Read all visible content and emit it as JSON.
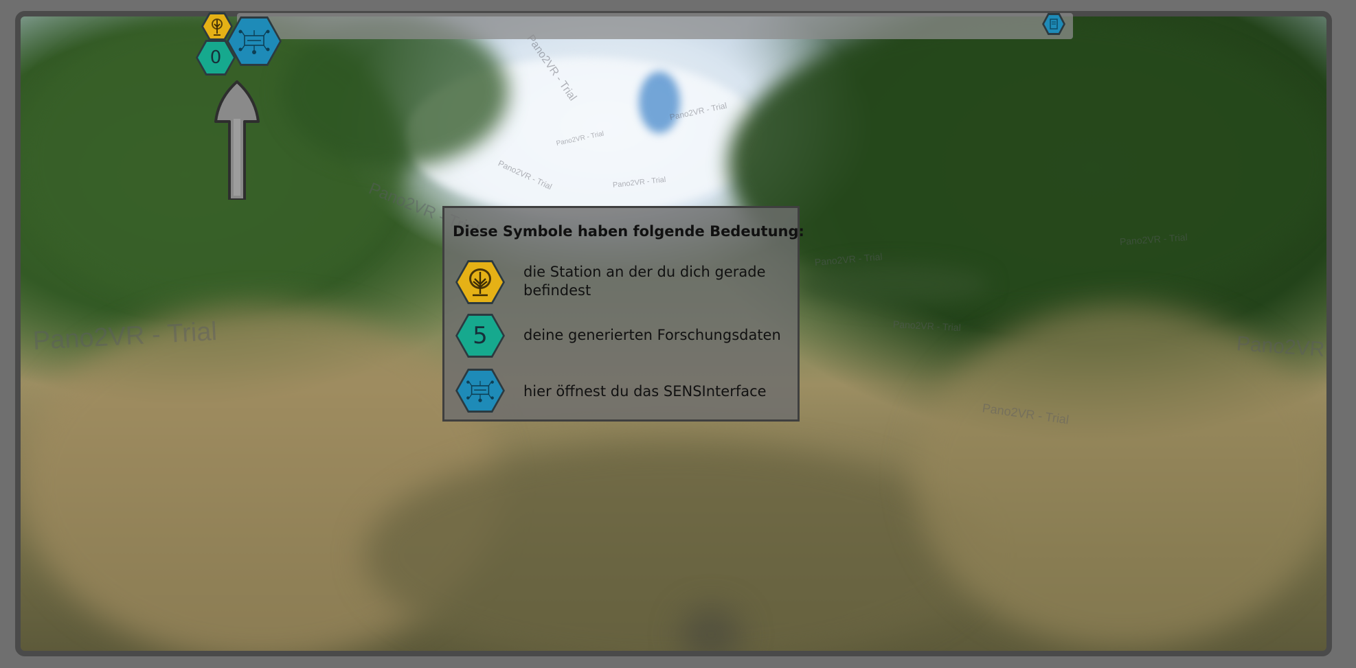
{
  "legend": {
    "title": "Diese Symbole haben folgende Bedeutung:",
    "rows": [
      {
        "icon": "tree-icon",
        "color": "#e5b116",
        "text": "die Station an der du dich gerade befindest"
      },
      {
        "icon": "data-counter-icon",
        "color": "#16a98e",
        "value": "5",
        "text": "deine generierten Forschungsdaten"
      },
      {
        "icon": "sens-interface-icon",
        "color": "#1e8bb8",
        "text": "hier öffnest du das SENSInterface"
      }
    ]
  },
  "hud": {
    "data_counter": "0",
    "station_icon": "tree-icon",
    "interface_icon": "sens-interface-icon",
    "top_right_icon": "document-icon",
    "nav_arrow": "arrow-up-icon"
  },
  "watermarks": [
    "Pano2VR - Trial",
    "Pano2VR - Trial",
    "Pano2VR - Trial",
    "Pano2VR - Trial",
    "Pano2VR - Trial",
    "Pano2VR - Trial",
    "Pano2VR - Trial",
    "Pano2VR - Trial",
    "Pano2VR - Trial",
    "Pano2VR - Trial",
    "Pano2VR - Trial",
    "Pano2VR - Trial"
  ],
  "colors": {
    "station": "#e5b116",
    "data": "#16a98e",
    "interface": "#1e8bb8",
    "frame": "#4a4a4a"
  }
}
